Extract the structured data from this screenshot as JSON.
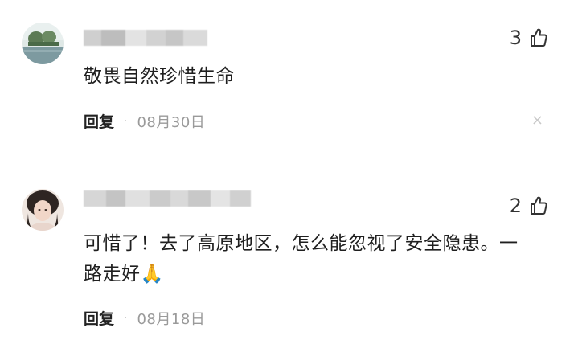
{
  "comments": [
    {
      "likes": "3",
      "text": "敬畏自然珍惜生命",
      "reply_label": "回复",
      "separator": "·",
      "date": "08月30日",
      "close": "×"
    },
    {
      "likes": "2",
      "text": "可惜了！去了高原地区，怎么能忽视了安全隐患。一路走好🙏",
      "reply_label": "回复",
      "separator": "·",
      "date": "08月18日",
      "close": "×"
    }
  ],
  "colors": {
    "like_icon": "#333333",
    "muted": "#9a9a9a"
  },
  "icons": {
    "like": "thumbs-up-icon",
    "dismiss": "close-icon"
  }
}
